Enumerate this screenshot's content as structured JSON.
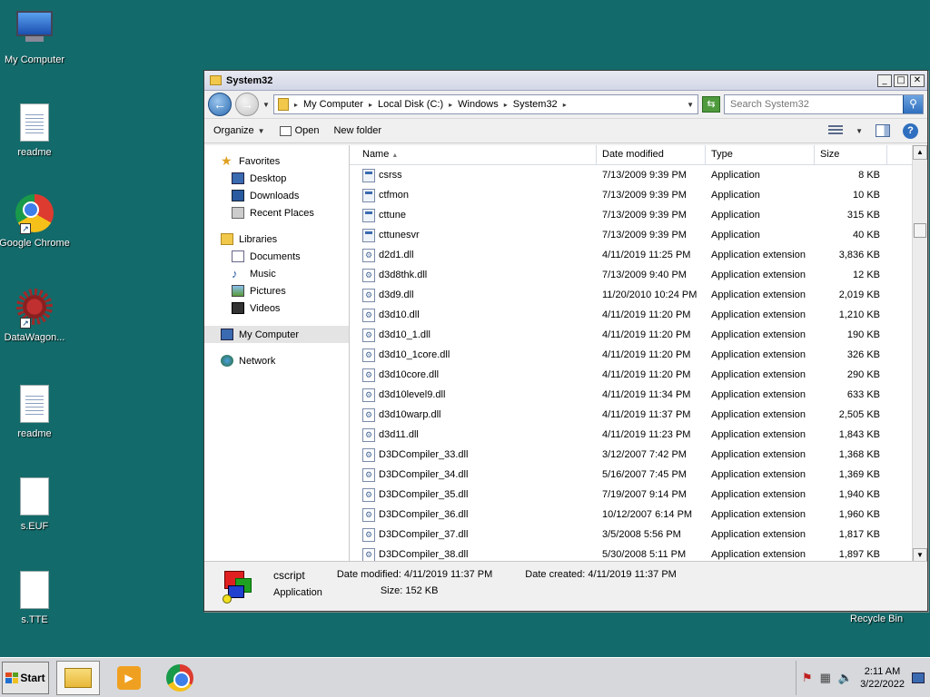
{
  "desktop": {
    "icons": [
      {
        "label": "My Computer"
      },
      {
        "label": "readme"
      },
      {
        "label": "Google Chrome"
      },
      {
        "label": "DataWagon..."
      },
      {
        "label": "readme"
      },
      {
        "label": "s.EUF"
      },
      {
        "label": "s.TTE"
      }
    ],
    "recycle_bin": "Recycle Bin"
  },
  "window": {
    "title": "System32",
    "controls": {
      "minimize": "_",
      "maximize": "□",
      "close": "✕"
    },
    "address": {
      "crumbs": [
        "My Computer",
        "Local Disk (C:)",
        "Windows",
        "System32"
      ]
    },
    "search": {
      "placeholder": "Search System32"
    },
    "toolbar": {
      "organize": "Organize",
      "open": "Open",
      "new_folder": "New folder"
    },
    "nav": {
      "favorites": "Favorites",
      "desktop": "Desktop",
      "downloads": "Downloads",
      "recent_places": "Recent Places",
      "libraries": "Libraries",
      "documents": "Documents",
      "music": "Music",
      "pictures": "Pictures",
      "videos": "Videos",
      "my_computer": "My Computer",
      "network": "Network"
    },
    "columns": {
      "name": "Name",
      "date": "Date modified",
      "type": "Type",
      "size": "Size"
    },
    "files": [
      {
        "name": "csrss",
        "date": "7/13/2009 9:39 PM",
        "type": "Application",
        "size": "8 KB",
        "kind": "app"
      },
      {
        "name": "ctfmon",
        "date": "7/13/2009 9:39 PM",
        "type": "Application",
        "size": "10 KB",
        "kind": "app"
      },
      {
        "name": "cttune",
        "date": "7/13/2009 9:39 PM",
        "type": "Application",
        "size": "315 KB",
        "kind": "app"
      },
      {
        "name": "cttunesvr",
        "date": "7/13/2009 9:39 PM",
        "type": "Application",
        "size": "40 KB",
        "kind": "app"
      },
      {
        "name": "d2d1.dll",
        "date": "4/11/2019 11:25 PM",
        "type": "Application extension",
        "size": "3,836 KB",
        "kind": "dll"
      },
      {
        "name": "d3d8thk.dll",
        "date": "7/13/2009 9:40 PM",
        "type": "Application extension",
        "size": "12 KB",
        "kind": "dll"
      },
      {
        "name": "d3d9.dll",
        "date": "11/20/2010 10:24 PM",
        "type": "Application extension",
        "size": "2,019 KB",
        "kind": "dll"
      },
      {
        "name": "d3d10.dll",
        "date": "4/11/2019 11:20 PM",
        "type": "Application extension",
        "size": "1,210 KB",
        "kind": "dll"
      },
      {
        "name": "d3d10_1.dll",
        "date": "4/11/2019 11:20 PM",
        "type": "Application extension",
        "size": "190 KB",
        "kind": "dll"
      },
      {
        "name": "d3d10_1core.dll",
        "date": "4/11/2019 11:20 PM",
        "type": "Application extension",
        "size": "326 KB",
        "kind": "dll"
      },
      {
        "name": "d3d10core.dll",
        "date": "4/11/2019 11:20 PM",
        "type": "Application extension",
        "size": "290 KB",
        "kind": "dll"
      },
      {
        "name": "d3d10level9.dll",
        "date": "4/11/2019 11:34 PM",
        "type": "Application extension",
        "size": "633 KB",
        "kind": "dll"
      },
      {
        "name": "d3d10warp.dll",
        "date": "4/11/2019 11:37 PM",
        "type": "Application extension",
        "size": "2,505 KB",
        "kind": "dll"
      },
      {
        "name": "d3d11.dll",
        "date": "4/11/2019 11:23 PM",
        "type": "Application extension",
        "size": "1,843 KB",
        "kind": "dll"
      },
      {
        "name": "D3DCompiler_33.dll",
        "date": "3/12/2007 7:42 PM",
        "type": "Application extension",
        "size": "1,368 KB",
        "kind": "dll"
      },
      {
        "name": "D3DCompiler_34.dll",
        "date": "5/16/2007 7:45 PM",
        "type": "Application extension",
        "size": "1,369 KB",
        "kind": "dll"
      },
      {
        "name": "D3DCompiler_35.dll",
        "date": "7/19/2007 9:14 PM",
        "type": "Application extension",
        "size": "1,940 KB",
        "kind": "dll"
      },
      {
        "name": "D3DCompiler_36.dll",
        "date": "10/12/2007 6:14 PM",
        "type": "Application extension",
        "size": "1,960 KB",
        "kind": "dll"
      },
      {
        "name": "D3DCompiler_37.dll",
        "date": "3/5/2008 5:56 PM",
        "type": "Application extension",
        "size": "1,817 KB",
        "kind": "dll"
      },
      {
        "name": "D3DCompiler_38.dll",
        "date": "5/30/2008 5:11 PM",
        "type": "Application extension",
        "size": "1,897 KB",
        "kind": "dll"
      }
    ],
    "details": {
      "name": "cscript",
      "type": "Application",
      "modified_label": "Date modified:",
      "modified": "4/11/2019 11:37 PM",
      "created_label": "Date created:",
      "created": "4/11/2019 11:37 PM",
      "size_label": "Size:",
      "size": "152 KB"
    }
  },
  "taskbar": {
    "start": "Start",
    "time": "2:11 AM",
    "date": "3/22/2022"
  }
}
